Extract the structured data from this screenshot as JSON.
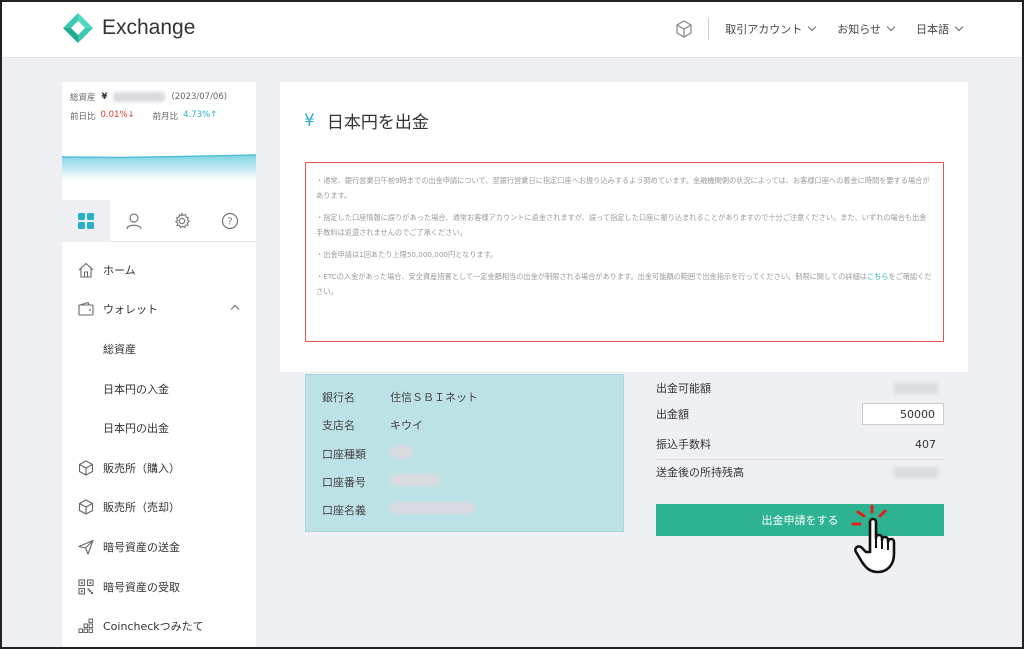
{
  "header": {
    "logo_text": "Exchange",
    "menus": [
      "取引アカウント",
      "お知らせ",
      "日本語"
    ]
  },
  "sidebar": {
    "asset_label": "総資産",
    "asset_currency": "¥",
    "asset_date": "(2023/07/06)",
    "day_label": "前日比",
    "day_value": "0.01%↓",
    "month_label": "前月比",
    "month_value": "4.73%↑",
    "nav": [
      {
        "label": "ホーム",
        "icon": "home-icon"
      },
      {
        "label": "ウォレット",
        "icon": "wallet-icon"
      },
      {
        "label": "総資産"
      },
      {
        "label": "日本円の入金"
      },
      {
        "label": "日本円の出金"
      },
      {
        "label": "販売所（購入）",
        "icon": "cube-icon"
      },
      {
        "label": "販売所（売却）",
        "icon": "cube-icon"
      },
      {
        "label": "暗号資産の送金",
        "icon": "send-icon"
      },
      {
        "label": "暗号資産の受取",
        "icon": "qr-icon"
      },
      {
        "label": "Coincheckつみたて",
        "icon": "blocks-icon"
      }
    ]
  },
  "main": {
    "title": "日本円を出金",
    "notice": {
      "p1": "・通常、銀行営業日午前9時までの出金申請について、翌銀行営業日に指定口座へお振り込みするよう努めています。金融機関側の状況によっては、お客様口座への着金に時間を要する場合があります。",
      "p2": "・指定した口座情報に誤りがあった場合、通常お客様アカウントに返金されますが、誤って指定した口座に振り込まれることがありますので十分ご注意ください。また、いずれの場合も出金手数料は返還されませんのでご了承ください。",
      "p3": "・出金申請は1回あたり上限50,000,000円となります。",
      "p4a": "・ETCの入金があった場合、安全資産措置として一定金額相当の出金が制限される場合があります。出金可能額の範囲で出金指示を行ってください。制限に関しての詳細は",
      "p4link": "こちら",
      "p4b": "をご確認ください。"
    }
  },
  "bank": {
    "rows": [
      {
        "key": "銀行名",
        "value": "住信ＳＢＩネット"
      },
      {
        "key": "支店名",
        "value": "キウイ"
      },
      {
        "key": "口座種類",
        "value": ""
      },
      {
        "key": "口座番号",
        "value": ""
      },
      {
        "key": "口座名義",
        "value": ""
      }
    ]
  },
  "withdraw": {
    "available_label": "出金可能額",
    "amount_label": "出金額",
    "amount_value": "50000",
    "fee_label": "振込手数料",
    "fee_value": "407",
    "balance_label": "送金後の所持残高",
    "submit_label": "出金申請をする"
  },
  "colors": {
    "accent": "#28b0c6",
    "button": "#2db391",
    "notice_border": "#e25850",
    "down": "#e0342c"
  }
}
